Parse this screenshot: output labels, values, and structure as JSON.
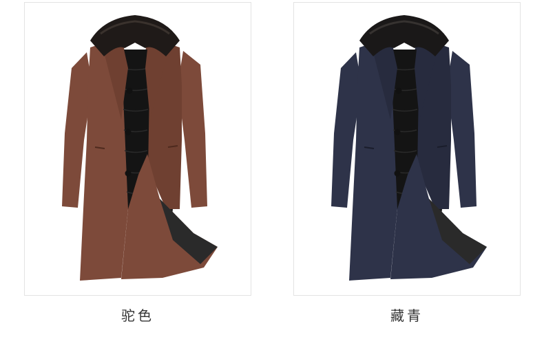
{
  "products": [
    {
      "color_name": "驼色",
      "image": "brown-wool-overcoat-with-fur-collar",
      "coat_color": "#7d4a3a",
      "coat_shadow": "#5e3326"
    },
    {
      "color_name": "藏青",
      "image": "navy-wool-overcoat-with-fur-collar",
      "coat_color": "#2e3349",
      "coat_shadow": "#1d2133"
    }
  ]
}
